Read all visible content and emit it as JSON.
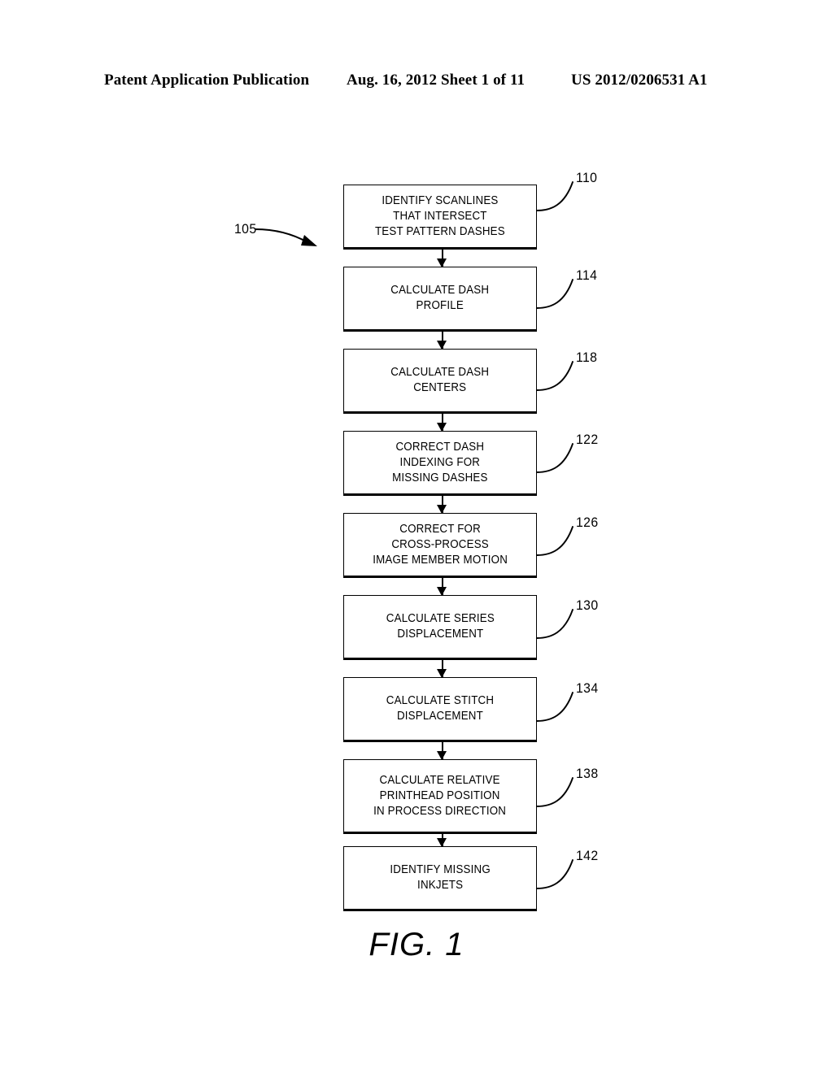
{
  "header": {
    "left": "Patent Application Publication",
    "middle": "Aug. 16, 2012  Sheet 1 of 11",
    "right": "US 2012/0206531 A1"
  },
  "figure": {
    "caption": "FIG. 1",
    "process_ref": "105",
    "steps": [
      {
        "ref": "110",
        "text": "IDENTIFY SCANLINES\nTHAT INTERSECT\nTEST PATTERN DASHES"
      },
      {
        "ref": "114",
        "text": "CALCULATE DASH\nPROFILE"
      },
      {
        "ref": "118",
        "text": "CALCULATE DASH\nCENTERS"
      },
      {
        "ref": "122",
        "text": "CORRECT DASH\nINDEXING FOR\nMISSING DASHES"
      },
      {
        "ref": "126",
        "text": "CORRECT FOR\nCROSS-PROCESS\nIMAGE MEMBER MOTION"
      },
      {
        "ref": "130",
        "text": "CALCULATE SERIES\nDISPLACEMENT"
      },
      {
        "ref": "134",
        "text": "CALCULATE STITCH\nDISPLACEMENT"
      },
      {
        "ref": "138",
        "text": "CALCULATE RELATIVE\nPRINTHEAD POSITION\nIN PROCESS DIRECTION"
      },
      {
        "ref": "142",
        "text": "IDENTIFY MISSING\nINKJETS"
      }
    ]
  }
}
